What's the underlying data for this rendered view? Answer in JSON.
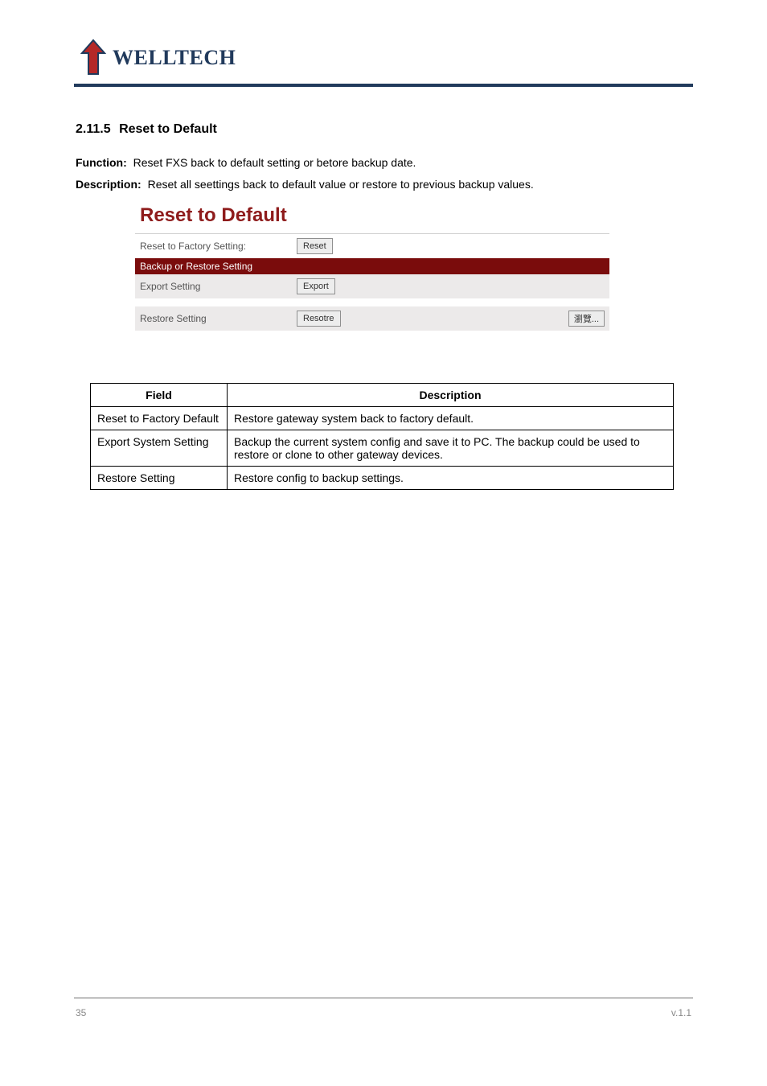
{
  "header": {
    "brand": "WELLTECH"
  },
  "section": {
    "number": "2.11.5",
    "title": "Reset to Default"
  },
  "meta": {
    "function_label": "Function:",
    "function_text": "Reset FXS back to default setting or betore backup date.",
    "description_label": "Description:",
    "description_text": "Reset all seettings back to default value or restore to previous backup values."
  },
  "shot": {
    "title": "Reset to Default",
    "row1_label": "Reset to Factory Setting:",
    "row1_btn": "Reset",
    "bar_label": "Backup or Restore Setting",
    "row_export_label": "Export Setting",
    "row_export_btn": "Export",
    "row_restore_label": "Restore Setting",
    "row_restore_btn": "Resotre",
    "browse_btn": "瀏覽..."
  },
  "table": {
    "head_field": "Field",
    "head_desc": "Description",
    "rows": [
      {
        "field": "Reset to Factory Default",
        "desc": "Restore gateway system back to factory default."
      },
      {
        "field": "Export System Setting",
        "desc": "Backup the current system config and save it to PC. The backup could be used to restore or clone to other gateway devices."
      },
      {
        "field": "Restore Setting",
        "desc": "Restore config to backup settings."
      }
    ]
  },
  "footer": {
    "left": "35",
    "right": "v.1.1"
  }
}
